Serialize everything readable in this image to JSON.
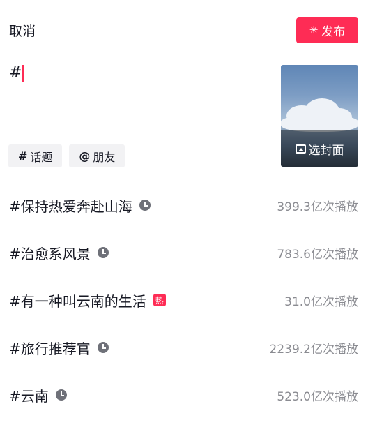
{
  "header": {
    "cancel_label": "取消",
    "publish_label": "发布",
    "publish_color": "#fe2c55"
  },
  "editor": {
    "text": "#"
  },
  "cover": {
    "label": "选封面",
    "icon": "image-icon"
  },
  "chips": [
    {
      "symbol": "#",
      "label": "话题",
      "icon": "hashtag-icon"
    },
    {
      "symbol": "@",
      "label": "朋友",
      "icon": "at-icon"
    }
  ],
  "suggestions": [
    {
      "tag": "#保持热爱奔赴山海",
      "badge": "clock-icon",
      "plays": "399.3亿次播放"
    },
    {
      "tag": "#治愈系风景",
      "badge": "clock-icon",
      "plays": "783.6亿次播放"
    },
    {
      "tag": "#有一种叫云南的生活",
      "badge": "hot",
      "badge_text": "热",
      "plays": "31.0亿次播放"
    },
    {
      "tag": "#旅行推荐官",
      "badge": "clock-icon",
      "plays": "2239.2亿次播放"
    },
    {
      "tag": "#云南",
      "badge": "clock-icon",
      "plays": "523.0亿次播放"
    }
  ]
}
